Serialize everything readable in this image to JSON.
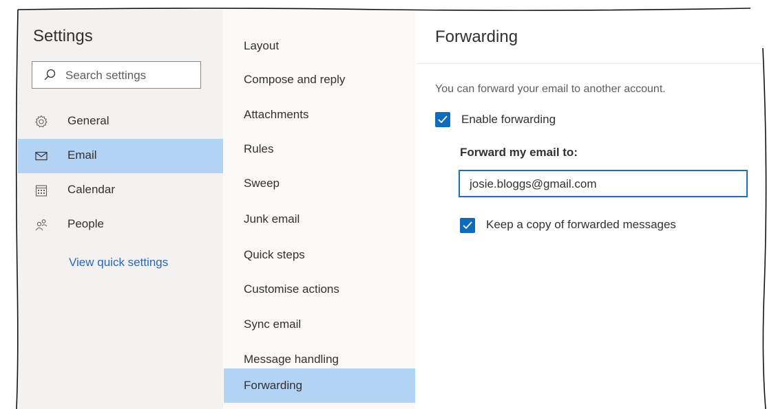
{
  "sidebar": {
    "title": "Settings",
    "search_placeholder": "Search settings",
    "items": [
      {
        "label": "General",
        "icon": "gear-icon"
      },
      {
        "label": "Email",
        "icon": "mail-icon",
        "selected": true
      },
      {
        "label": "Calendar",
        "icon": "calendar-icon"
      },
      {
        "label": "People",
        "icon": "people-icon"
      }
    ],
    "view_quick_settings": "View quick settings"
  },
  "email_menu": {
    "items": [
      "Layout",
      "Compose and reply",
      "Attachments",
      "Rules",
      "Sweep",
      "Junk email",
      "Quick steps",
      "Customise actions",
      "Sync email",
      "Message handling",
      "Forwarding"
    ],
    "selected": "Forwarding"
  },
  "forwarding": {
    "title": "Forwarding",
    "description": "You can forward your email to another account.",
    "enable_label": "Enable forwarding",
    "enable_checked": true,
    "forward_to_label": "Forward my email to:",
    "forward_to_value": "josie.bloggs@gmail.com",
    "keep_copy_label": "Keep a copy of forwarded messages",
    "keep_copy_checked": true
  },
  "colors": {
    "accent": "#0f6cbd",
    "selection": "#b3d3f5",
    "link": "#2b67b3"
  }
}
